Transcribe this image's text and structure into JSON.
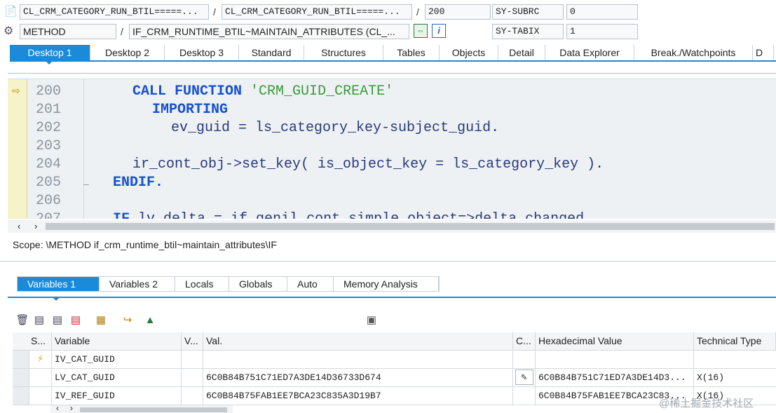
{
  "header": {
    "row1": {
      "icon": "document-icon",
      "program": "CL_CRM_CATEGORY_RUN_BTIL=====...",
      "include": "CL_CRM_CATEGORY_RUN_BTIL=====...",
      "line": "200",
      "sysfield_name": "SY-SUBRC",
      "sysfield_value": "0"
    },
    "row2": {
      "icon": "method-gear-icon",
      "event_type": "METHOD",
      "event": "IF_CRM_RUNTIME_BTIL~MAINTAIN_ATTRIBUTES (CL_...",
      "sysfield_name": "SY-TABIX",
      "sysfield_value": "1"
    },
    "separator": "/"
  },
  "desktop_tabs": [
    "Desktop 1",
    "Desktop 2",
    "Desktop 3",
    "Standard",
    "Structures",
    "Tables",
    "Objects",
    "Detail",
    "Data Explorer",
    "Break./Watchpoints",
    "D"
  ],
  "code": {
    "lines": [
      {
        "num": "200",
        "current": true
      },
      {
        "num": "201"
      },
      {
        "num": "202"
      },
      {
        "num": "203"
      },
      {
        "num": "204"
      },
      {
        "num": "205"
      },
      {
        "num": "206"
      },
      {
        "num": "207"
      }
    ],
    "text": {
      "l200_kw1": "CALL FUNCTION",
      "l200_str": "'CRM_GUID_CREATE'",
      "l201_kw": "IMPORTING",
      "l202": "ev_guid = ls_category_key-subject_guid.",
      "l204": "ir_cont_obj->set_key( is_object_key = ls_category_key ).",
      "l205_kw": "ENDIF.",
      "l207_kw": "IF",
      "l207": "lv_delta = if_genil_cont_simple_object=>delta_changed"
    }
  },
  "scope": "Scope: \\METHOD if_crm_runtime_btil~maintain_attributes\\IF",
  "variable_tabs": [
    "Variables 1",
    "Variables 2",
    "Locals",
    "Globals",
    "Auto",
    "Memory Analysis"
  ],
  "grid": {
    "headers": {
      "s": "S...",
      "variable": "Variable",
      "v": "V...",
      "val": "Val.",
      "c": "C...",
      "hex": "Hexadecimal Value",
      "type": "Technical Type"
    },
    "rows": [
      {
        "variable": "IV_CAT_GUID",
        "val": "",
        "hex": "",
        "type": "",
        "status_icon": "lightning-icon"
      },
      {
        "variable": "LV_CAT_GUID",
        "val": "6C0B84B751C71ED7A3DE14D36733D674",
        "hex": "6C0B84B751C71ED7A3DE14D3...",
        "type": "X(16)",
        "edit_icon": "pencil-icon"
      },
      {
        "variable": "IV_REF_GUID",
        "val": "6C0B84B75FAB1EE7BCA23C835A3D19B7",
        "hex": "6C0B84B75FAB1EE7BCA23C83...",
        "type": "X(16)"
      }
    ]
  },
  "watermark": "@稀土掘金技术社区"
}
